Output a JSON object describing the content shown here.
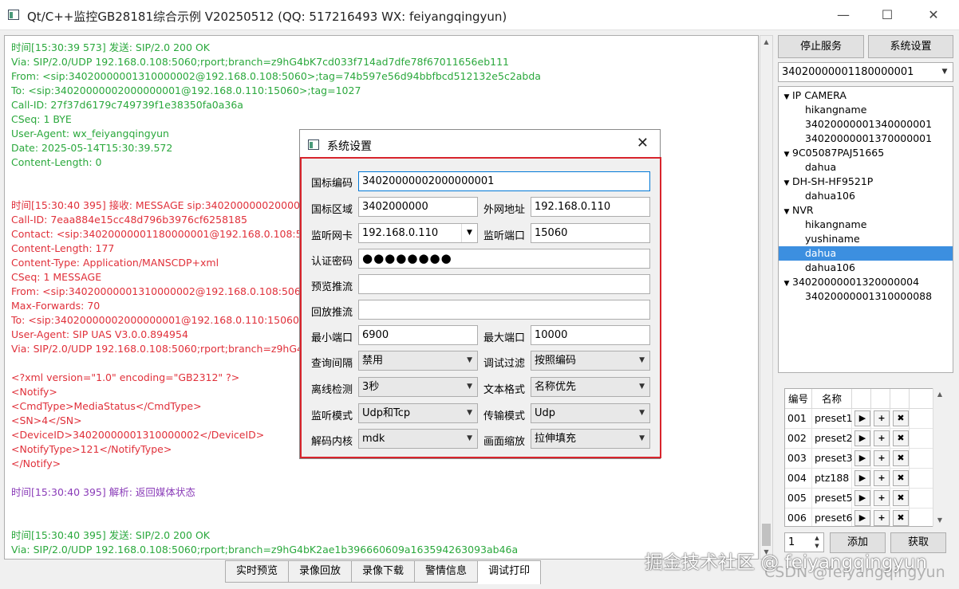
{
  "window": {
    "title": "Qt/C++监控GB28181综合示例 V20250512 (QQ: 517216493 WX: feiyangqingyun)",
    "minimize": "—",
    "maximize": "☐",
    "close": "✕"
  },
  "log": {
    "lines": [
      {
        "text": "时间[15:30:39 573] 发送: SIP/2.0 200 OK",
        "color": "green"
      },
      {
        "text": "Via: SIP/2.0/UDP 192.168.0.108:5060;rport;branch=z9hG4bK7cd033f714ad7dfe78f67011656eb111",
        "color": "green"
      },
      {
        "text": "From: <sip:34020000001310000002@192.168.0.108:5060>;tag=74b597e56d94bbfbcd512132e5c2abda",
        "color": "green"
      },
      {
        "text": "To: <sip:34020000002000000001@192.168.0.110:15060>;tag=1027",
        "color": "green"
      },
      {
        "text": "Call-ID: 27f37d6179c749739f1e38350fa0a36a",
        "color": "green"
      },
      {
        "text": "CSeq: 1 BYE",
        "color": "green"
      },
      {
        "text": "User-Agent: wx_feiyangqingyun",
        "color": "green"
      },
      {
        "text": "Date: 2025-05-14T15:30:39.572",
        "color": "green"
      },
      {
        "text": "Content-Length: 0",
        "color": "green"
      },
      {
        "text": "",
        "color": "green"
      },
      {
        "text": "",
        "color": "green"
      },
      {
        "text": "时间[15:30:40 395] 接收: MESSAGE sip:34020000002000000",
        "color": "red"
      },
      {
        "text": "Call-ID: 7eaa884e15cc48d796b3976cf6258185",
        "color": "red"
      },
      {
        "text": "Contact: <sip:34020000001180000001@192.168.0.108:50",
        "color": "red"
      },
      {
        "text": "Content-Length: 177",
        "color": "red"
      },
      {
        "text": "Content-Type: Application/MANSCDP+xml",
        "color": "red"
      },
      {
        "text": "CSeq: 1 MESSAGE",
        "color": "red"
      },
      {
        "text": "From: <sip:34020000001310000002@192.168.0.108:5060>",
        "color": "red"
      },
      {
        "text": "Max-Forwards: 70",
        "color": "red"
      },
      {
        "text": "To: <sip:34020000002000000001@192.168.0.110:15060>;t",
        "color": "red"
      },
      {
        "text": "User-Agent: SIP UAS V3.0.0.894954",
        "color": "red"
      },
      {
        "text": "Via: SIP/2.0/UDP 192.168.0.108:5060;rport;branch=z9hG4",
        "color": "red"
      },
      {
        "text": "",
        "color": "red"
      },
      {
        "text": "<?xml version=\"1.0\" encoding=\"GB2312\" ?>",
        "color": "red"
      },
      {
        "text": "<Notify>",
        "color": "red"
      },
      {
        "text": " <CmdType>MediaStatus</CmdType>",
        "color": "red"
      },
      {
        "text": " <SN>4</SN>",
        "color": "red"
      },
      {
        "text": " <DeviceID>34020000001310000002</DeviceID>",
        "color": "red"
      },
      {
        "text": " <NotifyType>121</NotifyType>",
        "color": "red"
      },
      {
        "text": "</Notify>",
        "color": "red"
      },
      {
        "text": "",
        "color": "red"
      },
      {
        "text": "时间[15:30:40 395] 解析: 返回媒体状态",
        "color": "purple"
      },
      {
        "text": "",
        "color": "purple"
      },
      {
        "text": "",
        "color": "purple"
      },
      {
        "text": "时间[15:30:40 395] 发送: SIP/2.0 200 OK",
        "color": "green"
      },
      {
        "text": "Via: SIP/2.0/UDP 192.168.0.108:5060;rport;branch=z9hG4bK2ae1b396660609a163594263093ab46a",
        "color": "green"
      }
    ]
  },
  "colors": {
    "green": "#2aa83c",
    "red": "#e0303a",
    "purple": "#8a3cb8",
    "selection": "#3c8fe0",
    "dialog_border": "#d8242c"
  },
  "bottom_tabs": [
    {
      "label": "实时预览",
      "active": false
    },
    {
      "label": "录像回放",
      "active": false
    },
    {
      "label": "录像下载",
      "active": false
    },
    {
      "label": "警情信息",
      "active": false
    },
    {
      "label": "调试打印",
      "active": true
    }
  ],
  "right": {
    "stop_service": "停止服务",
    "system_settings": "系统设置",
    "device_combo": "34020000001180000001",
    "tree": [
      {
        "label": "IP CAMERA",
        "level": 0,
        "expanded": true
      },
      {
        "label": "hikangname",
        "level": 1
      },
      {
        "label": "34020000001340000001",
        "level": 1
      },
      {
        "label": "34020000001370000001",
        "level": 1
      },
      {
        "label": "9C05087PAJ51665",
        "level": 0,
        "expanded": true
      },
      {
        "label": "dahua",
        "level": 1
      },
      {
        "label": "DH-SH-HF9521P",
        "level": 0,
        "expanded": true
      },
      {
        "label": "dahua106",
        "level": 1
      },
      {
        "label": "NVR",
        "level": 0,
        "expanded": true
      },
      {
        "label": "hikangname",
        "level": 1
      },
      {
        "label": "yushiname",
        "level": 1
      },
      {
        "label": "dahua",
        "level": 1,
        "selected": true
      },
      {
        "label": "dahua106",
        "level": 1
      },
      {
        "label": "34020000001320000004",
        "level": 0,
        "expanded": true
      },
      {
        "label": "34020000001310000088",
        "level": 1
      }
    ],
    "preset_headers": {
      "number": "编号",
      "name": "名称"
    },
    "presets": [
      {
        "no": "001",
        "name": "preset1"
      },
      {
        "no": "002",
        "name": "preset2"
      },
      {
        "no": "003",
        "name": "preset3"
      },
      {
        "no": "004",
        "name": "ptz188"
      },
      {
        "no": "005",
        "name": "preset5"
      },
      {
        "no": "006",
        "name": "preset6"
      }
    ],
    "preset_icons": {
      "play": "▶",
      "add": "+",
      "delete": "✖"
    },
    "spin_value": "1",
    "add_button": "添加",
    "fetch_button": "获取",
    "watermark": "掘金技术社区 @ feiyangqingyun",
    "watermark2": "CSDN @feiyangqingyun"
  },
  "dialog": {
    "title": "系统设置",
    "close": "✕",
    "labels": {
      "gb_code": "国标编码",
      "gb_area": "国标区域",
      "wan_addr": "外网地址",
      "listen_nic": "监听网卡",
      "listen_port": "监听端口",
      "auth_pwd": "认证密码",
      "preview_push": "预览推流",
      "playback_push": "回放推流",
      "min_port": "最小端口",
      "max_port": "最大端口",
      "query_interval": "查询间隔",
      "debug_filter": "调试过滤",
      "offline_detect": "离线检测",
      "text_format": "文本格式",
      "listen_mode": "监听模式",
      "transport_mode": "传输模式",
      "decode_core": "解码内核",
      "picture_scale": "画面缩放"
    },
    "values": {
      "gb_code": "34020000002000000001",
      "gb_area": "3402000000",
      "wan_addr": "192.168.0.110",
      "listen_nic": "192.168.0.110",
      "listen_port": "15060",
      "auth_pwd": "●●●●●●●●",
      "preview_push": "",
      "playback_push": "",
      "min_port": "6900",
      "max_port": "10000",
      "query_interval": "禁用",
      "debug_filter": "按照编码",
      "offline_detect": "3秒",
      "text_format": "名称优先",
      "listen_mode": "Udp和Tcp",
      "transport_mode": "Udp",
      "decode_core": "mdk",
      "picture_scale": "拉伸填充"
    }
  }
}
